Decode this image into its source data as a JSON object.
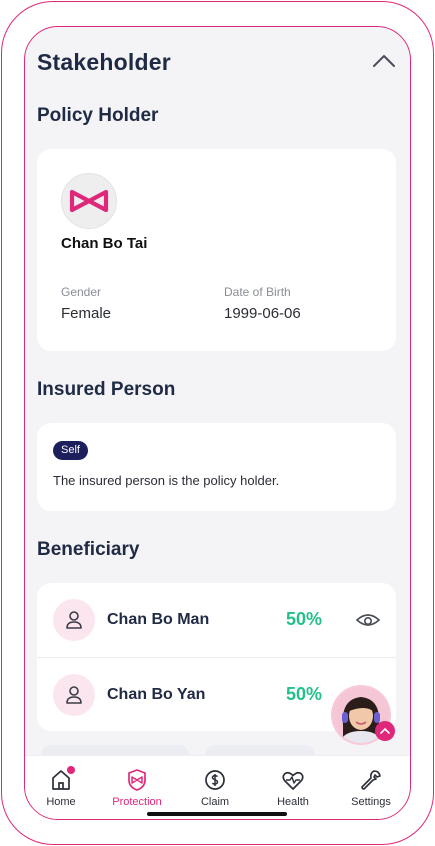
{
  "section": {
    "title": "Stakeholder"
  },
  "policy_holder": {
    "heading": "Policy Holder",
    "name": "Chan Bo Tai",
    "gender_label": "Gender",
    "gender_value": "Female",
    "dob_label": "Date of Birth",
    "dob_value": "1999-06-06"
  },
  "insured": {
    "heading": "Insured Person",
    "badge": "Self",
    "text": "The insured person is the policy holder."
  },
  "beneficiary": {
    "heading": "Beneficiary",
    "items": [
      {
        "name": "Chan Bo Man",
        "percent": "50%"
      },
      {
        "name": "Chan Bo Yan",
        "percent": "50%"
      }
    ]
  },
  "nav": {
    "items": [
      {
        "label": "Home",
        "icon": "home-icon"
      },
      {
        "label": "Protection",
        "icon": "shield-icon",
        "active": true
      },
      {
        "label": "Claim",
        "icon": "claim-icon"
      },
      {
        "label": "Health",
        "icon": "heart-pulse-icon"
      },
      {
        "label": "Settings",
        "icon": "wrench-icon"
      }
    ]
  },
  "colors": {
    "accent": "#e0287a",
    "positive": "#24c08a",
    "heading": "#1f2a44",
    "badge_bg": "#1d1e5c"
  }
}
